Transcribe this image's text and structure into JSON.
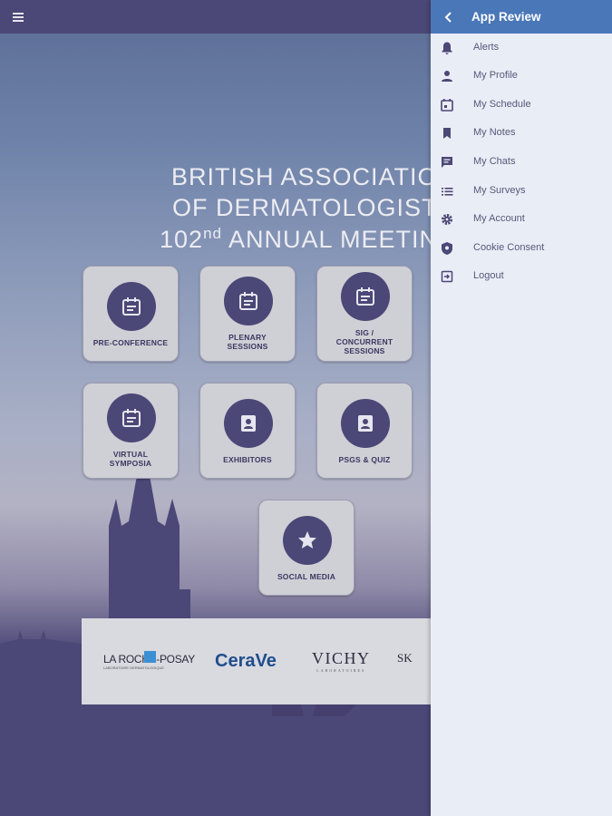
{
  "topbar": {
    "menu_icon": "hamburger-menu-icon"
  },
  "title": {
    "line1": "BRITISH ASSOCIATION",
    "line2": "OF DERMATOLOGISTS",
    "line3_num": "102",
    "line3_sup": "nd",
    "line3_rest": " ANNUAL MEETING"
  },
  "tiles": [
    {
      "label": "PRE-CONFERENCE",
      "icon": "calendar-icon"
    },
    {
      "label": "PLENARY SESSIONS",
      "icon": "calendar-icon"
    },
    {
      "label": "SIG / CONCURRENT SESSIONS",
      "icon": "calendar-icon"
    },
    {
      "label": "VIRTUAL SYMPOSIA",
      "icon": "calendar-icon"
    },
    {
      "label": "EXHIBITORS",
      "icon": "badge-icon"
    },
    {
      "label": "PSGS & QUIZ",
      "icon": "badge-icon"
    },
    {
      "label": "SOCIAL MEDIA",
      "icon": "star-icon"
    }
  ],
  "sponsors": {
    "laroche": "LA ROCHE-POSAY",
    "laroche_sub": "LABORATOIRE DERMATOLOGIQUE",
    "cerave": "CeraVe",
    "vichy": "VICHY",
    "vichy_sub": "LABORATOIRES",
    "skin": "SK"
  },
  "drawer": {
    "title": "App Review",
    "items": [
      {
        "label": "Alerts",
        "icon": "bell-icon"
      },
      {
        "label": "My Profile",
        "icon": "person-icon"
      },
      {
        "label": "My Schedule",
        "icon": "calendar-icon"
      },
      {
        "label": "My Notes",
        "icon": "bookmark-icon"
      },
      {
        "label": "My Chats",
        "icon": "chat-icon"
      },
      {
        "label": "My Surveys",
        "icon": "list-icon"
      },
      {
        "label": "My Account",
        "icon": "gear-icon"
      },
      {
        "label": "Cookie Consent",
        "icon": "shield-icon"
      },
      {
        "label": "Logout",
        "icon": "logout-icon"
      }
    ]
  },
  "colors": {
    "primary": "#4b4776",
    "drawer_header": "#4a77b8",
    "drawer_bg": "#e9edf6",
    "tile_bg": "#cfcfd6"
  }
}
